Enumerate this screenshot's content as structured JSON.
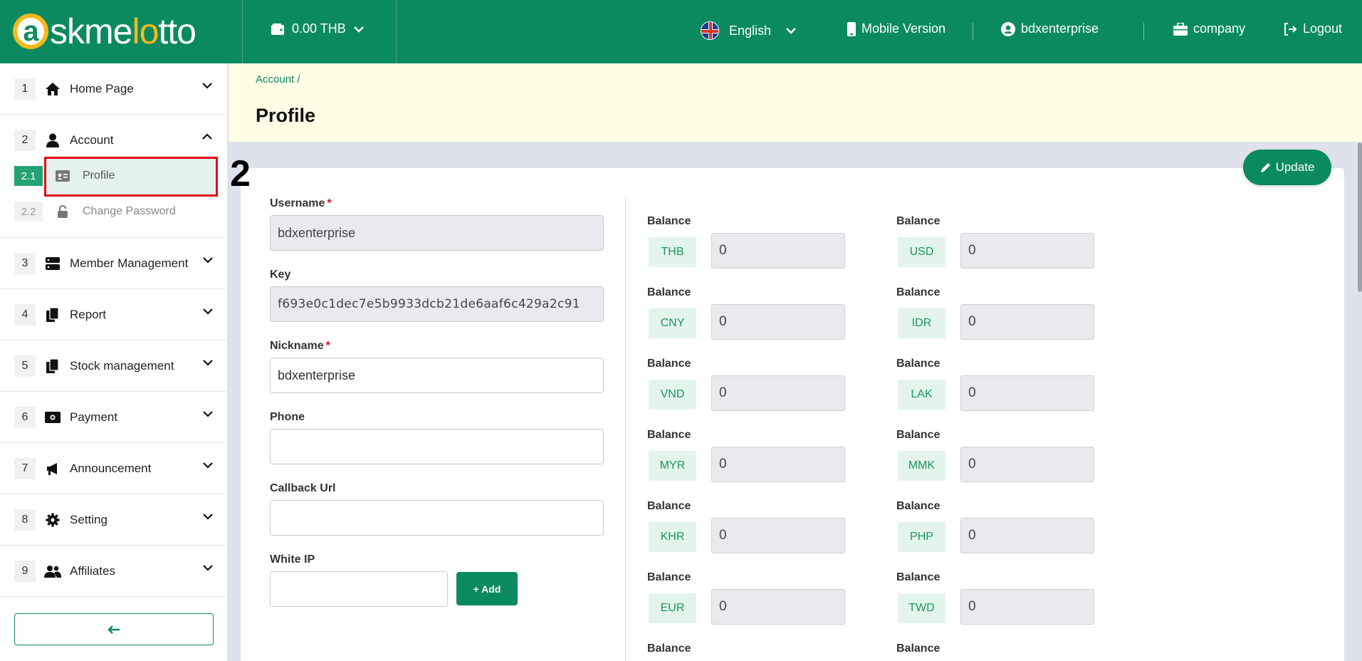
{
  "topbar": {
    "logo": {
      "w1": "skme",
      "w2": "lo",
      "w3": "tto",
      "ring": "a"
    },
    "wallet": "0.00 THB",
    "language": "English",
    "mobile": "Mobile Version",
    "user": "bdxenterprise",
    "company": "company",
    "logout": "Logout"
  },
  "sidebar": {
    "home": {
      "num": "1",
      "label": "Home Page"
    },
    "account": {
      "num": "2",
      "label": "Account"
    },
    "profile": {
      "num": "2.1",
      "label": "Profile"
    },
    "change_password": {
      "num": "2.2",
      "label": "Change Password"
    },
    "items": [
      {
        "num": "3",
        "label": "Member Management",
        "icon": "server-icon"
      },
      {
        "num": "4",
        "label": "Report",
        "icon": "report-icon"
      },
      {
        "num": "5",
        "label": "Stock management",
        "icon": "stock-icon"
      },
      {
        "num": "6",
        "label": "Payment",
        "icon": "payment-icon"
      },
      {
        "num": "7",
        "label": "Announcement",
        "icon": "megaphone-icon"
      },
      {
        "num": "8",
        "label": "Setting",
        "icon": "gear-icon"
      },
      {
        "num": "9",
        "label": "Affiliates",
        "icon": "users-icon"
      }
    ]
  },
  "header": {
    "breadcrumb": "Account /",
    "title": "Profile"
  },
  "step_marker": "2",
  "update_label": "Update",
  "form": {
    "username": {
      "label": "Username",
      "value": "bdxenterprise"
    },
    "key": {
      "label": "Key",
      "value": "f693e0c1dec7e5b9933dcb21de6aaf6c429a2c91"
    },
    "nickname": {
      "label": "Nickname",
      "value": "bdxenterprise"
    },
    "phone": {
      "label": "Phone",
      "value": ""
    },
    "callback": {
      "label": "Callback Url",
      "value": ""
    },
    "white_ip": {
      "label": "White IP",
      "value": ""
    },
    "required_mark": "*",
    "add_label": "+ Add"
  },
  "balances": {
    "label": "Balance",
    "items": [
      {
        "currency": "THB",
        "value": "0"
      },
      {
        "currency": "USD",
        "value": "0"
      },
      {
        "currency": "CNY",
        "value": "0"
      },
      {
        "currency": "IDR",
        "value": "0"
      },
      {
        "currency": "VND",
        "value": "0"
      },
      {
        "currency": "LAK",
        "value": "0"
      },
      {
        "currency": "MYR",
        "value": "0"
      },
      {
        "currency": "MMK",
        "value": "0"
      },
      {
        "currency": "KHR",
        "value": "0"
      },
      {
        "currency": "PHP",
        "value": "0"
      },
      {
        "currency": "EUR",
        "value": "0"
      },
      {
        "currency": "TWD",
        "value": "0"
      }
    ]
  },
  "colors": {
    "primary": "#0b8a60",
    "header_bg": "#fefde5",
    "highlight": "#e10b1a"
  }
}
